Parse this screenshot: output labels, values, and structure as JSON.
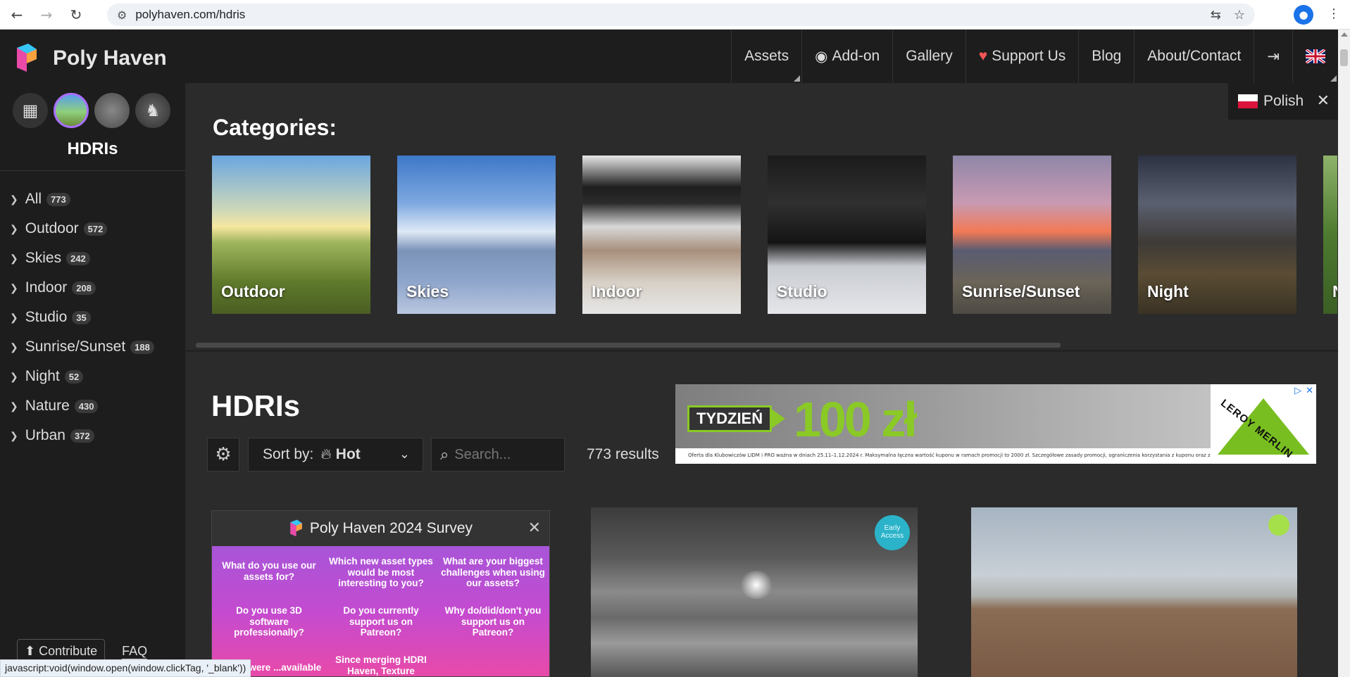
{
  "browser": {
    "url": "polyhaven.com/hdris"
  },
  "header": {
    "site_title": "Poly Haven",
    "nav": [
      {
        "label": "Assets"
      },
      {
        "label": "Add-on"
      },
      {
        "label": "Gallery"
      },
      {
        "label": "Support Us"
      },
      {
        "label": "Blog"
      },
      {
        "label": "About/Contact"
      }
    ]
  },
  "language_popup": {
    "label": "Polish"
  },
  "sidebar": {
    "title": "HDRIs",
    "categories": [
      {
        "label": "All",
        "count": "773"
      },
      {
        "label": "Outdoor",
        "count": "572"
      },
      {
        "label": "Skies",
        "count": "242"
      },
      {
        "label": "Indoor",
        "count": "208"
      },
      {
        "label": "Studio",
        "count": "35"
      },
      {
        "label": "Sunrise/Sunset",
        "count": "188"
      },
      {
        "label": "Night",
        "count": "52"
      },
      {
        "label": "Nature",
        "count": "430"
      },
      {
        "label": "Urban",
        "count": "372"
      }
    ],
    "contribute_label": "Contribute",
    "faq_label": "FAQ"
  },
  "categories_section": {
    "heading": "Categories:",
    "cards": [
      {
        "label": "Outdoor"
      },
      {
        "label": "Skies"
      },
      {
        "label": "Indoor"
      },
      {
        "label": "Studio"
      },
      {
        "label": "Sunrise/Sunset"
      },
      {
        "label": "Night"
      },
      {
        "label": "N"
      }
    ]
  },
  "listing": {
    "title": "HDRIs",
    "sort_label": "Sort by:",
    "sort_value": "Hot",
    "search_placeholder": "Search...",
    "results": "773 results"
  },
  "ad": {
    "badge": "TYDZIEŃ",
    "amount": "100 zł",
    "brand": "LEROY MERLIN",
    "fine_print": "Oferta dla Klubowiczów LIDM i PRO ważna w dniach 25.11–1.12.2024 r. Maksymalna łączna wartość kuponu w ramach promocji to 2000 zł. Szczegółowe zasady promocji, ograniczenia korzystania z kuponu oraz zasady zwrotu towarów nabytych z wykorzystaniem kuponu w regulaminie promocji w sklepach oraz na leroymerlin.pl"
  },
  "survey": {
    "title": "Poly Haven 2024 Survey",
    "questions": [
      "What do you use our assets for?",
      "Which new asset types would be most interesting to you?",
      "What are your biggest challenges when using our assets?",
      "Do you use 3D software professionally?",
      "Do you currently support us on Patreon?",
      "Why do/did/don't you support us on Patreon?",
      "Since merging HDRI Haven, Texture",
      "...aven were ...available"
    ]
  },
  "thumbnails": {
    "early_access": "Early Access"
  },
  "status_bar": {
    "text": "javascript:void(window.open(window.clickTag, '_blank'))"
  }
}
